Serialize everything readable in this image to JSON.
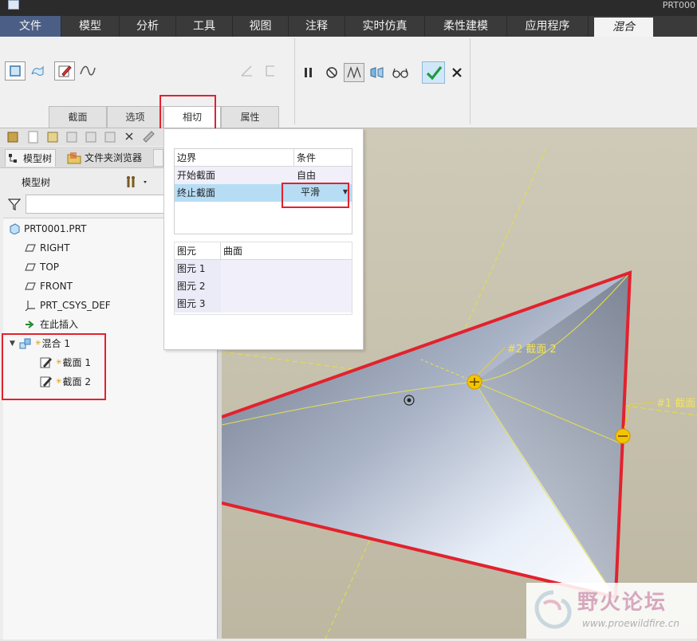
{
  "window": {
    "title": "PRT000"
  },
  "menu": {
    "items": [
      "文件",
      "模型",
      "分析",
      "工具",
      "视图",
      "注释",
      "实时仿真",
      "柔性建模",
      "应用程序"
    ],
    "active": "混合"
  },
  "ribbon": {
    "subtabs": [
      "截面",
      "选项",
      "相切",
      "属性"
    ],
    "selected_subtab": "相切"
  },
  "left_pane": {
    "tabs": [
      "模型树",
      "文件夹浏览器"
    ],
    "tree_header": "模型树",
    "tree": [
      {
        "label": "PRT0001.PRT",
        "icon": "part-icon"
      },
      {
        "label": "RIGHT",
        "icon": "datum-plane-icon"
      },
      {
        "label": "TOP",
        "icon": "datum-plane-icon"
      },
      {
        "label": "FRONT",
        "icon": "datum-plane-icon"
      },
      {
        "label": "PRT_CSYS_DEF",
        "icon": "csys-icon"
      },
      {
        "label": "在此插入",
        "icon": "insert-arrow-icon"
      },
      {
        "label": "混合 1",
        "icon": "blend-icon"
      },
      {
        "label": "截面 1",
        "icon": "sketch-icon"
      },
      {
        "label": "截面 2",
        "icon": "sketch-icon"
      }
    ]
  },
  "tangency_panel": {
    "boundary_table": {
      "headers": [
        "边界",
        "条件"
      ],
      "rows": [
        {
          "boundary": "开始截面",
          "condition": "自由"
        },
        {
          "boundary": "终止截面",
          "condition": "平滑"
        }
      ]
    },
    "element_table": {
      "headers": [
        "图元",
        "曲面"
      ],
      "rows": [
        "图元 1",
        "图元 2",
        "图元 3"
      ]
    }
  },
  "viewport": {
    "labels": {
      "section2": "#2 截面 2",
      "section1": "#1 截面"
    }
  },
  "watermark": {
    "text": "野火论坛",
    "url": "www.proewildfire.cn"
  },
  "colors": {
    "accent_red": "#e2222e",
    "selection_blue": "#b7ddf5",
    "label_yellow": "#f5c400",
    "menu_dark": "#3a3a3a"
  }
}
